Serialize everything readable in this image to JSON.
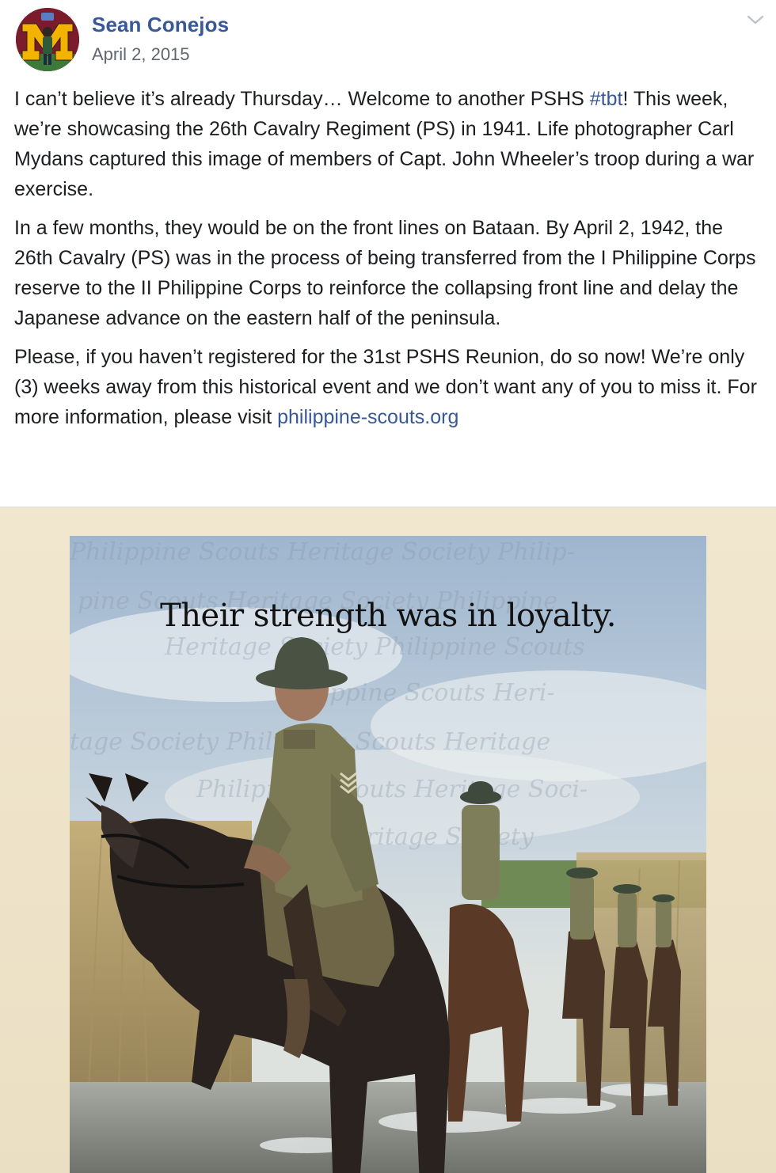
{
  "post": {
    "author": "Sean Conejos",
    "date": "April 2, 2015",
    "options_icon": "chevron-down-icon",
    "paragraphs": {
      "p1": {
        "before_hashtag": "I can’t believe it’s already Thursday… Welcome to another PSHS ",
        "hashtag": "#tbt",
        "after_hashtag": "! This week, we’re showcasing the 26th Cavalry Regiment (PS) in 1941. Life photographer Carl Mydans captured this image of members of Capt. John Wheeler’s troop during a war exercise."
      },
      "p2": "In a few months, they would be on the front lines on Bataan. By April 2, 1942, the 26th Cavalry (PS) was in the process of being transferred from the I Philippine Corps reserve to the II Philippine Corps to reinforce the collapsing front line and delay the Japanese advance on the eastern half of the peninsula.",
      "p3": {
        "before_link": "Please, if you haven’t registered for the 31st PSHS Reunion, do so now! We’re only (3) weeks away from this historical event and we don’t want any of you to miss it. For more information, please visit ",
        "link": "philippine-scouts.org"
      }
    },
    "image": {
      "headline": "Their strength was in loyalty."
    }
  },
  "colors": {
    "link": "#385898",
    "text": "#1c1e21",
    "meta": "#616770",
    "frame": "#efe4ca"
  }
}
